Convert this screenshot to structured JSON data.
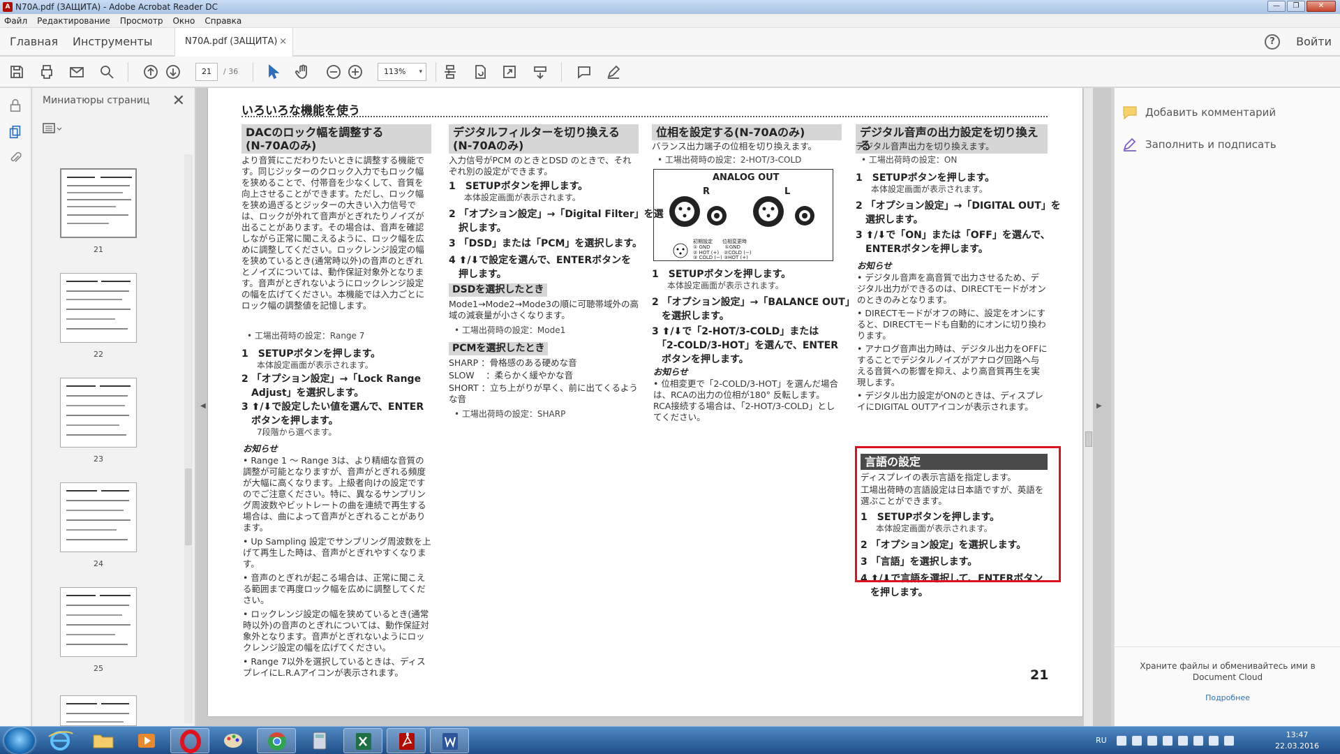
{
  "window": {
    "title": "N70A.pdf (ЗАЩИТА) - Adobe Acrobat Reader DC",
    "minimize": "—",
    "maximize": "❐",
    "close": "✕"
  },
  "menu": [
    "Файл",
    "Редактирование",
    "Просмотр",
    "Окно",
    "Справка"
  ],
  "tabs": {
    "home": "Главная",
    "tools": "Инструменты",
    "document": "N70A.pdf (ЗАЩИТА)",
    "close_glyph": "×",
    "help": "?",
    "signin": "Войти"
  },
  "toolbar": {
    "page_current": "21",
    "page_total": "/ 36",
    "zoom": "113%",
    "zoom_dd": "▾"
  },
  "thumbnails": {
    "title": "Миниатюры страниц",
    "close": "✕",
    "pages": [
      "21",
      "22",
      "23",
      "24",
      "25"
    ]
  },
  "right_panel": {
    "add_comment": "Добавить комментарий",
    "fill_sign": "Заполнить и подписать",
    "promo": "Храните файлы и обменивайтесь ими в Document Cloud",
    "more": "Подробнее"
  },
  "doc": {
    "heading": "いろいろな機能を使う",
    "col1": {
      "title": "DACのロック幅を調整する\n(N-70Aのみ)",
      "intro": "より音質にこだわりたいときに調整する機能です。同じジッターのクロック入力でもロック幅を狭めることで、付帯音を少なくして、音質を向上させることができます。ただし、ロック幅を狭め過ぎるとジッターの大きい入力信号では、ロックが外れて音声がとぎれたりノイズが出ることがあります。その場合は、音声を確認しながら正常に聞こえるように、ロック幅を広めに調整してください。ロックレンジ設定の幅を狭めているとき(通常時以外)の音声のとぎれとノイズについては、動作保証対象外となります。音声がとぎれないようにロックレンジ設定の幅を広げてください。本機能では入力ごとにロック幅の調整値を記憶します。",
      "default": "• 工場出荷時の設定：Range 7",
      "s1": "1　SETUPボタンを押します。",
      "s1sub": "本体設定画面が表示されます。",
      "s2": "2 「オプション設定」→「Lock Range\n　Adjust」を選択します。",
      "s3": "3 ⬆/⬇で設定したい値を選んで、ENTER\n　ボタンを押します。",
      "s3sub": "7段階から選べます。",
      "note": "お知らせ",
      "notes": [
        "• Range 1 ～ Range 3は、より精細な音質の調整が可能となりますが、音声がとぎれる頻度が大幅に高くなります。上級者向けの設定ですのでご注意ください。特に、異なるサンプリング周波数やビットレートの曲を連続で再生する場合は、曲によって音声がとぎれることがあります。",
        "• Up Sampling 設定でサンプリング周波数を上げて再生した時は、音声がとぎれやすくなります。",
        "• 音声のとぎれが起こる場合は、正常に聞こえる範囲まで再度ロック幅を広めに調整してください。",
        "• ロックレンジ設定の幅を狭めているとき(通常時以外)の音声のとぎれについては、動作保証対象外となります。音声がとぎれないようにロックレンジ設定の幅を広げてください。",
        "• Range 7以外を選択しているときは、ディスプレイにL.R.Aアイコンが表示されます。"
      ]
    },
    "col2": {
      "title": "デジタルフィルターを切り換える\n(N-70Aのみ)",
      "intro": "入力信号がPCM のときとDSD のときで、それぞれ別の設定ができます。",
      "s1": "1　SETUPボタンを押します。",
      "s1sub": "本体設定画面が表示されます。",
      "s2": "2 「オプション設定」→「Digital Filter」を選\n　択します。",
      "s3": "3 「DSD」または「PCM」を選択します。",
      "s4": "4 ⬆/⬇で設定を選んで、ENTERボタンを\n　押します。",
      "dsd": "DSDを選択したとき",
      "dsd_text": "Mode1→Mode2→Mode3の順に可聴帯域外の高域の減衰量が小さくなります。",
      "dsd_default": "• 工場出荷時の設定：Mode1",
      "pcm": "PCMを選択したとき",
      "pcm_sharp": "SHARP ：骨格感のある硬めな音",
      "pcm_slow": "SLOW 　：柔らかく緩やかな音",
      "pcm_short": "SHORT ：立ち上がりが早く、前に出てくるような音",
      "pcm_default": "• 工場出荷時の設定：SHARP"
    },
    "col3": {
      "title": "位相を設定する(N-70Aのみ)",
      "intro": "バランス出力端子の位相を切り換えます。",
      "default": "• 工場出荷時の設定：2-HOT/3-COLD",
      "fig_title": "ANALOG OUT",
      "fig_r": "R",
      "fig_l": "L",
      "fig_legend_a": "初期設定　　位相変更時",
      "fig_legend_b": "① GND　　　①GND",
      "fig_legend_c": "② HOT (+)　②COLD (−)",
      "fig_legend_d": "③ COLD (−)  ③HOT (+)",
      "s1": "1　SETUPボタンを押します。",
      "s1sub": "本体設定画面が表示されます。",
      "s2": "2 「オプション設定」→「BALANCE OUT」\n　を選択します。",
      "s3": "3 ⬆/⬇で「2-HOT/3-COLD」または\n　「2-COLD/3-HOT」を選んで、ENTER\n　ボタンを押します。",
      "note": "お知らせ",
      "notes": [
        "• 位相変更で「2-COLD/3-HOT」を選んだ場合は、RCAの出力の位相が180° 反転します。RCA接続する場合は、「2-HOT/3-COLD」としてください。"
      ]
    },
    "col4": {
      "title": "デジタル音声の出力設定を切り換える",
      "intro": "デジタル音声出力を切り換えます。",
      "default": "• 工場出荷時の設定：ON",
      "s1": "1　SETUPボタンを押します。",
      "s1sub": "本体設定画面が表示されます。",
      "s2": "2 「オプション設定」→「DIGITAL OUT」を\n　選択します。",
      "s3": "3 ⬆/⬇で「ON」または「OFF」を選んで、\n　ENTERボタンを押します。",
      "note": "お知らせ",
      "notes": [
        "• デジタル音声を高音質で出力させるため、デジタル出力ができるのは、DIRECTモードがオンのときのみとなります。",
        "• DIRECTモードがオフの時に、設定をオンにすると、DIRECTモードも自動的にオンに切り換わります。",
        "• アナログ音声出力時は、デジタル出力をOFFにすることでデジタルノイズがアナログ回路へ与える音質への影響を抑え、より高音質再生を実現します。",
        "• デジタル出力設定がONのときは、ディスプレイにDIGITAL OUTアイコンが表示されます。"
      ],
      "lang_title": "言語の設定",
      "lang_intro1": "ディスプレイの表示言語を指定します。",
      "lang_intro2": "工場出荷時の言語設定は日本語ですが、英語を選ぶことができます。",
      "ls1": "1　SETUPボタンを押します。",
      "ls1sub": "本体設定画面が表示されます。",
      "ls2": "2 「オプション設定」を選択します。",
      "ls3": "3 「言語」を選択します。",
      "ls4": "4 ⬆/⬇で言語を選択して、ENTERボタン\n　を押します。"
    },
    "page_number": "21"
  },
  "taskbar": {
    "lang": "RU",
    "time": "13:47",
    "date": "22.03.2016"
  },
  "colors": {
    "highlight": "#e0101c",
    "acrobat_red": "#b30b00",
    "taskbar": "#1d4e87"
  }
}
